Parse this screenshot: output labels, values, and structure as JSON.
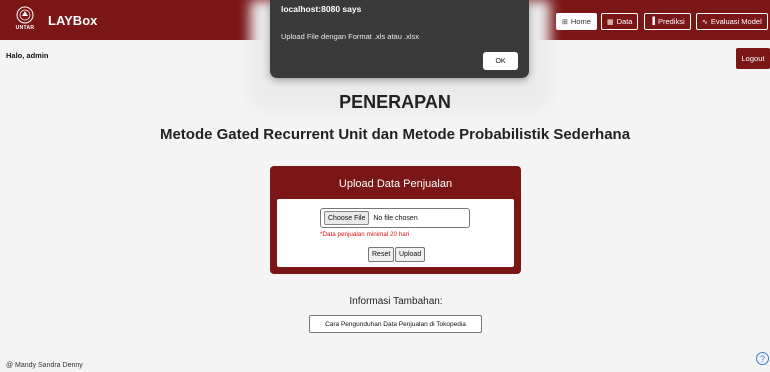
{
  "navbar": {
    "logo_text": "UNTAR",
    "brand": "LAYBox",
    "items": [
      {
        "label": "Home",
        "icon": "grid-icon",
        "active": true
      },
      {
        "label": "Data",
        "icon": "table-icon",
        "active": false
      },
      {
        "label": "Prediksi",
        "icon": "bar-chart-icon",
        "active": false
      },
      {
        "label": "Evaluasi Model",
        "icon": "line-chart-icon",
        "active": false
      }
    ],
    "logout_label": "Logout",
    "color": "#7b1616"
  },
  "greeting": "Halo, admin",
  "main": {
    "title": "PENERAPAN",
    "subtitle": "Metode Gated Recurrent Unit dan Metode Probabilistik Sederhana"
  },
  "upload_card": {
    "title": "Upload Data Penjualan",
    "choose_file_label": "Choose File",
    "file_status": "No file chosen",
    "note": "*Data penjualan minimal 20 hari",
    "reset_label": "Reset",
    "upload_label": "Upload"
  },
  "info": {
    "title": "Informasi Tambahan:",
    "button_label": "Cara Pengunduhan Data Penjualan di Tokopedia"
  },
  "footer": "@ Mandy Sandra Denny",
  "help_icon": "?",
  "alert": {
    "title": "localhost:8080 says",
    "message": "Upload File dengan Format .xls atau .xlsx",
    "ok_label": "OK"
  }
}
